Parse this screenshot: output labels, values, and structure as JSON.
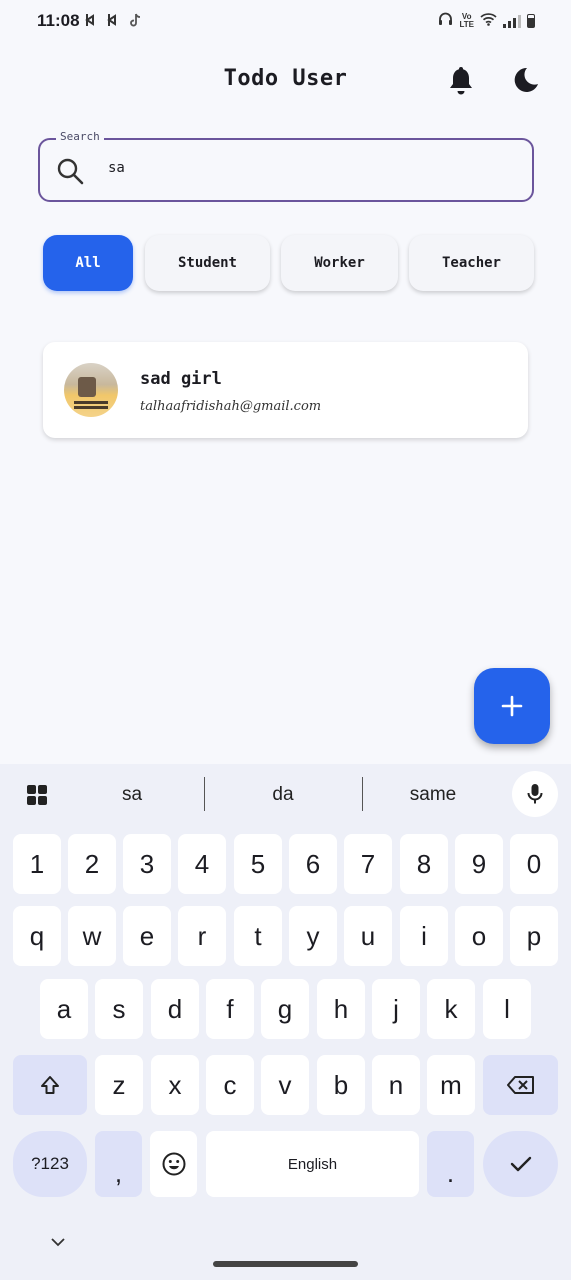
{
  "status_bar": {
    "time": "11:08",
    "notifications": [
      "b-icon",
      "b-icon",
      "tiktok-icon"
    ],
    "volte": "Vo\nLTE"
  },
  "app_bar": {
    "title": "Todo User",
    "icons": [
      "bell-icon",
      "moon-icon"
    ]
  },
  "search": {
    "label": "Search",
    "value": "sa",
    "accent": "#6b559c"
  },
  "filters": {
    "items": [
      "All",
      "Student",
      "Worker",
      "Teacher"
    ],
    "selected": "All",
    "accent": "#2563eb"
  },
  "users": [
    {
      "name": "sad girl",
      "email": "talhaafridishah@gmail.com"
    }
  ],
  "fab": {
    "icon": "plus-icon",
    "color": "#2563eb"
  },
  "keyboard": {
    "suggestions": [
      "sa",
      "da",
      "same"
    ],
    "row_numbers": [
      "1",
      "2",
      "3",
      "4",
      "5",
      "6",
      "7",
      "8",
      "9",
      "0"
    ],
    "row_top": [
      "q",
      "w",
      "e",
      "r",
      "t",
      "y",
      "u",
      "i",
      "o",
      "p"
    ],
    "row_home": [
      "a",
      "s",
      "d",
      "f",
      "g",
      "h",
      "j",
      "k",
      "l"
    ],
    "row_bottom": [
      "z",
      "x",
      "c",
      "v",
      "b",
      "n",
      "m"
    ],
    "symbols_label": "?123",
    "comma_label": ",",
    "space_label": "English",
    "period_label": "."
  }
}
